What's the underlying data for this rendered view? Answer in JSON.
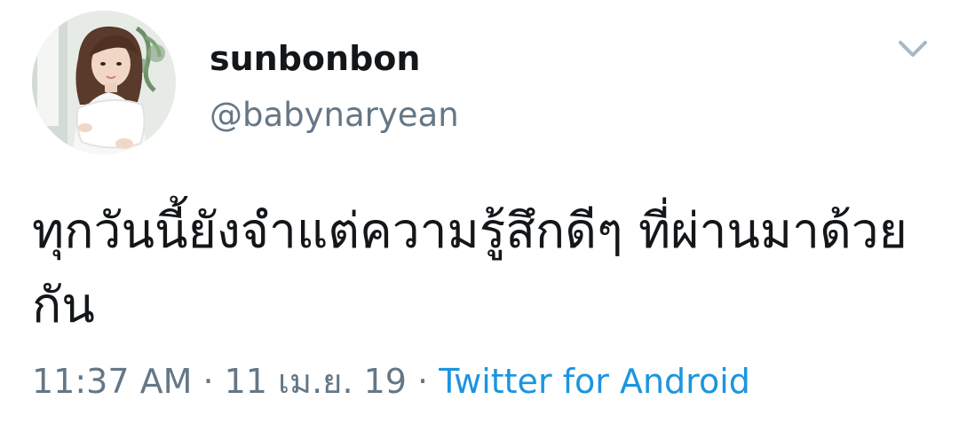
{
  "tweet": {
    "author": {
      "display_name": "sunbonbon",
      "handle": "@babynaryean",
      "avatar_icon": "user-avatar-photo"
    },
    "menu_icon": "chevron-down-icon",
    "text": "ทุกวันนี้ยังจำแต่ความรู้สึกดีๆ ที่ผ่านมาด้วยกัน",
    "meta": {
      "time": "11:37 AM",
      "separator_1": " · ",
      "date": "11 เม.ย. 19",
      "separator_2": " · ",
      "source": "Twitter for Android"
    }
  },
  "colors": {
    "text_primary": "#14171a",
    "text_secondary": "#657786",
    "link": "#1b95e0",
    "chevron": "#aab8c2",
    "background": "#ffffff"
  }
}
